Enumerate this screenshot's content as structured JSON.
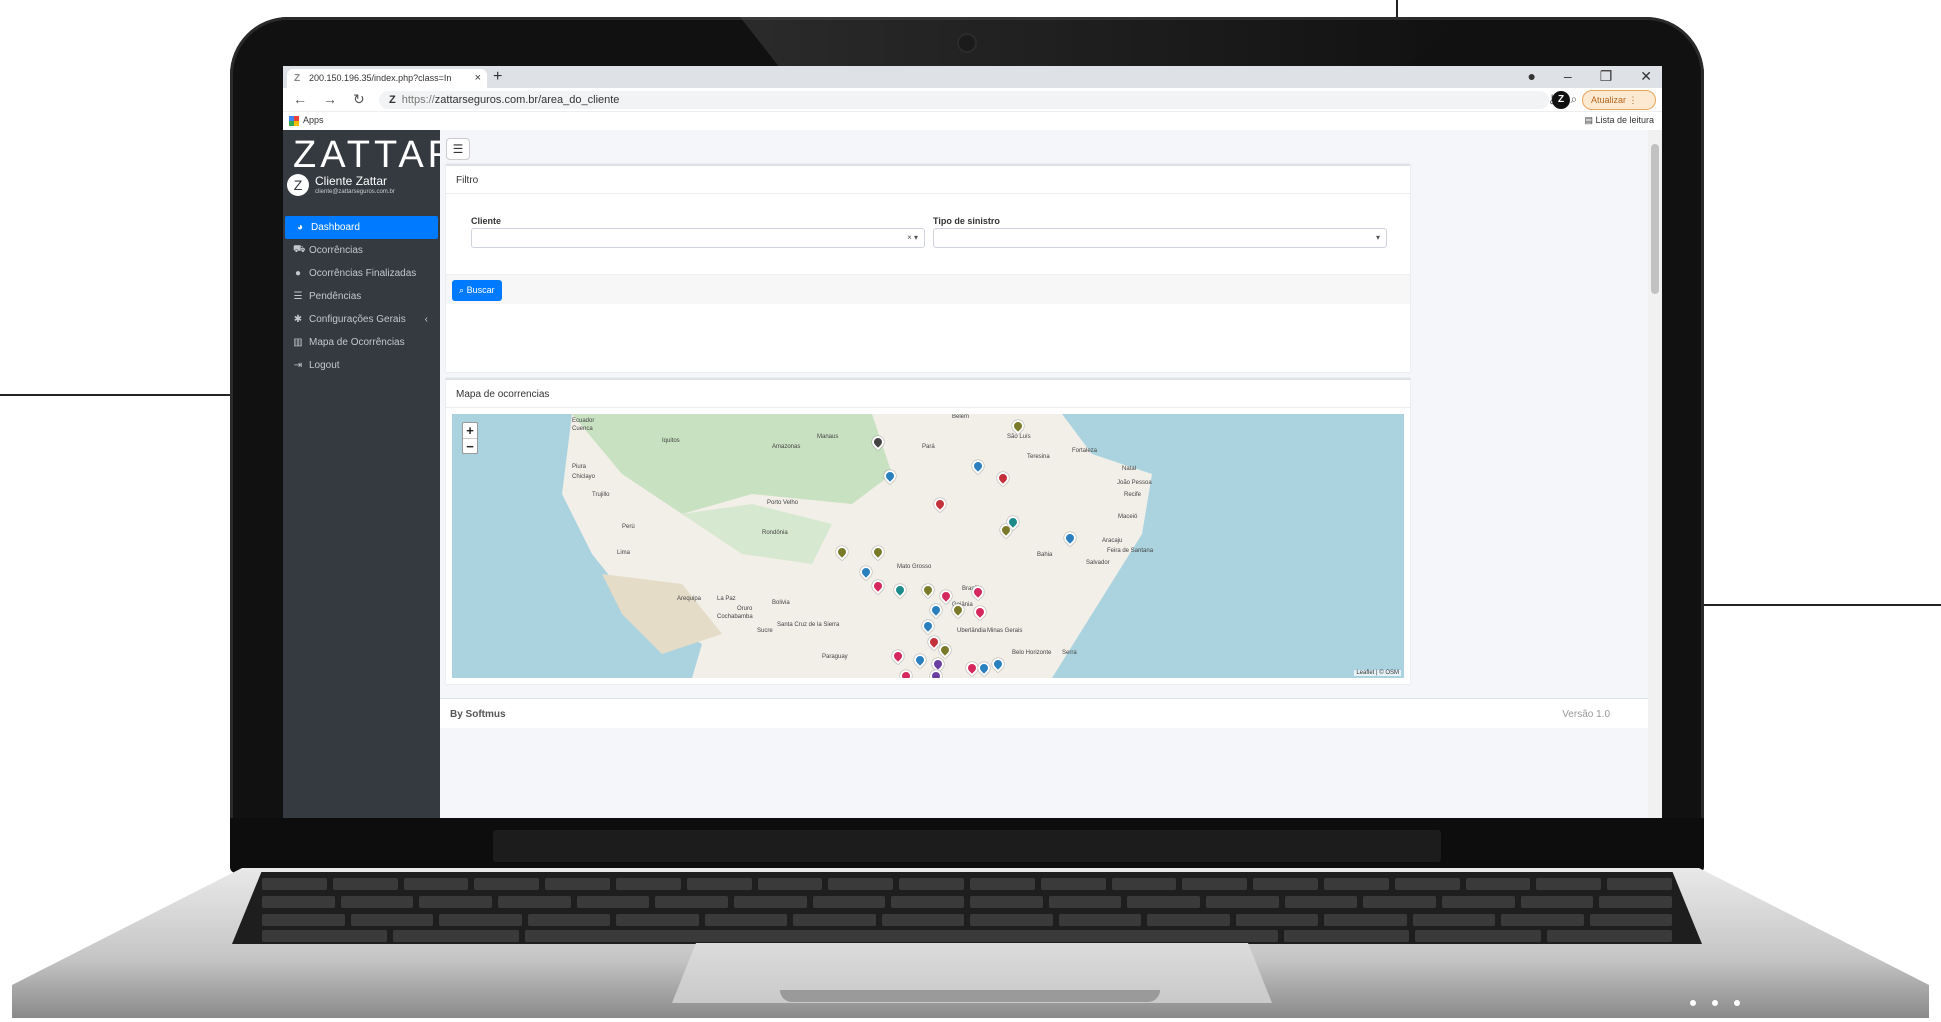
{
  "browser": {
    "tab_title": "200.150.196.35/index.php?class=In",
    "tab_favicon": "Z",
    "url_scheme": "https://",
    "url_rest": "zattarseguros.com.br/area_do_cliente",
    "update_label": "Atualizar",
    "profile_initial": "Z",
    "apps_label": "Apps",
    "reading_list_label": "Lista de leitura"
  },
  "sidebar": {
    "logo": "ZATTAR",
    "user_initial": "Z",
    "user_name": "Cliente Zattar",
    "user_email": "cliente@zattarseguros.com.br",
    "items": [
      {
        "label": "Dashboard",
        "icon": "chart-pie-icon"
      },
      {
        "label": "Ocorrências",
        "icon": "car-icon"
      },
      {
        "label": "Ocorrências Finalizadas",
        "icon": "circle-icon"
      },
      {
        "label": "Pendências",
        "icon": "list-icon"
      },
      {
        "label": "Configurações Gerais",
        "icon": "gear-icon"
      },
      {
        "label": "Mapa de Ocorrências",
        "icon": "map-icon"
      },
      {
        "label": "Logout",
        "icon": "logout-icon"
      }
    ]
  },
  "filter": {
    "title": "Filtro",
    "cliente_label": "Cliente",
    "tipo_label": "Tipo de sinistro",
    "clear_symbol": "×",
    "button": "Buscar"
  },
  "map": {
    "title": "Mapa de ocorrencias",
    "attribution": "Leaflet | © OSM",
    "zoom_in": "+",
    "zoom_out": "−",
    "labels": [
      "Ecuador",
      "Cuenca",
      "Iquitos",
      "Manaus",
      "Belém",
      "São Luís",
      "Teresina",
      "Fortaleza",
      "Natal",
      "João Pessoa",
      "Recife",
      "Maceió",
      "Aracaju",
      "Feira de Santana",
      "Salvador",
      "Piura",
      "Chiclayo",
      "Trujillo",
      "Porto Velho",
      "Perú",
      "Lima",
      "Arequipa",
      "La Paz",
      "Bolivia",
      "Cochabamba",
      "Oruro",
      "Sucre",
      "Santa Cruz de la Sierra",
      "Brasília",
      "Goiânia",
      "Uberlândia",
      "Belo Horizonte",
      "Serra",
      "Amazonas",
      "Pará",
      "Rondônia",
      "Mato Grosso",
      "Bahia",
      "Minas Gerais",
      "Paraguay"
    ],
    "pin_colors": [
      "#2a7fbf",
      "#c3323a",
      "#7a7a2a",
      "#d4285e",
      "#1f8a8a",
      "#e06c2a",
      "#444444",
      "#6b3fa0"
    ]
  },
  "footer": {
    "by": "By Softmus",
    "version": "Versão 1.0"
  }
}
